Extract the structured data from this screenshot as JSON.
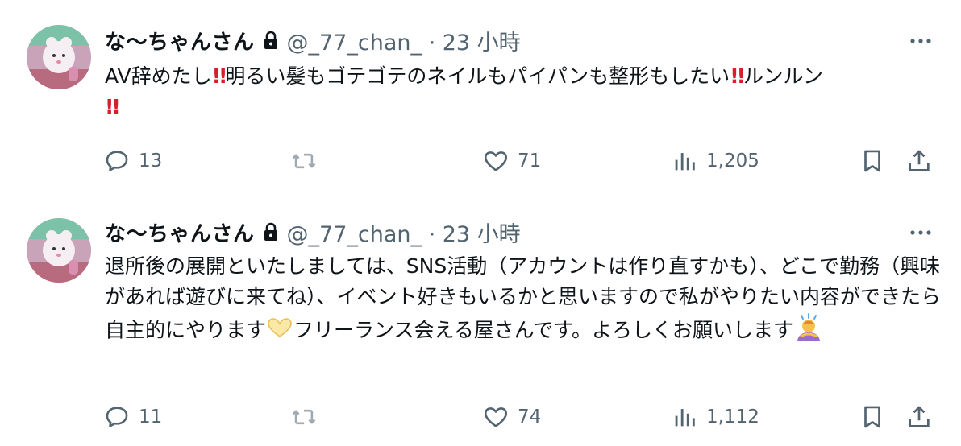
{
  "tweets": [
    {
      "author_name": "な〜ちゃんさん",
      "meta": "@_77_chan_ · 23 小時",
      "text_parts": [
        "AV辞めたし",
        "!!",
        "明るい髪もゴテゴテのネイルもパイパンも整形もしたい",
        "!!",
        "ルンルン\n",
        "!!"
      ],
      "reply_count": "13",
      "retweet_count": "",
      "like_count": "71",
      "view_count": "1,205"
    },
    {
      "author_name": "な〜ちゃんさん",
      "meta": "@_77_chan_ · 23 小時",
      "text_parts": [
        "退所後の展開といたしましては、SNS活動（アカウントは作り直すかも）、どこで勤務（興味があれば遊びに来てね）、イベント好きもいるかと思いますので私がやりたい内容ができたら自主的にやります",
        "フリーランス会える屋さんです。よろしくお願いします"
      ],
      "reply_count": "11",
      "retweet_count": "",
      "like_count": "74",
      "view_count": "1,112"
    }
  ],
  "icons": {
    "lock": "lock-icon",
    "more": "more-dots-icon",
    "reply": "reply-bubble-icon",
    "retweet": "retweet-icon",
    "like": "heart-icon",
    "views": "views-chart-icon",
    "bookmark": "bookmark-icon",
    "share": "share-upload-icon",
    "emoji_heart_hands": "heart-hands-emoji",
    "emoji_bowing": "person-bowing-emoji"
  },
  "colors": {
    "text": "#0f1419",
    "secondary": "#536471",
    "double_exclamation": "#d61f2c",
    "divider": "#eff3f4"
  }
}
